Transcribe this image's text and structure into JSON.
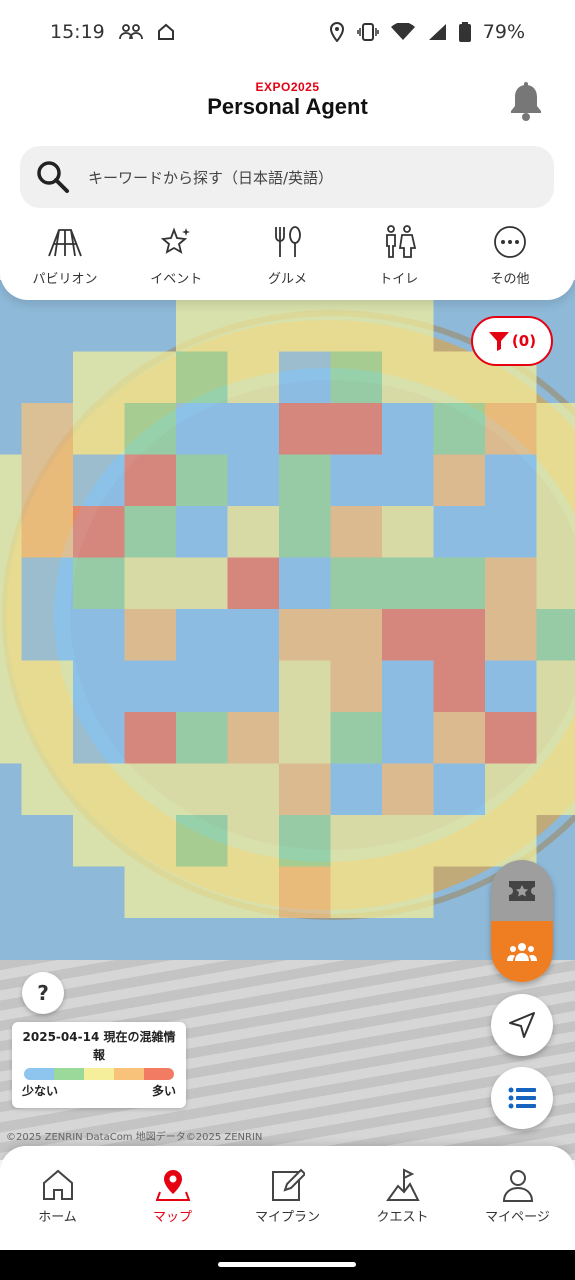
{
  "status": {
    "time": "15:19",
    "battery": "79%"
  },
  "header": {
    "brand_small": "EXPO2025",
    "brand_big": "Personal Agent",
    "search_placeholder": "キーワードから探す（日本語/英語）",
    "categories": [
      {
        "label": "パビリオン",
        "icon": "pavilion-icon"
      },
      {
        "label": "イベント",
        "icon": "event-icon"
      },
      {
        "label": "グルメ",
        "icon": "gourmet-icon"
      },
      {
        "label": "トイレ",
        "icon": "toilet-icon"
      },
      {
        "label": "その他",
        "icon": "more-icon"
      }
    ]
  },
  "map": {
    "filter_count": "(0)",
    "legend": {
      "title": "2025-04-14 現在の混雑情報",
      "low": "少ない",
      "high": "多い"
    },
    "copyright": "©2025 ZENRIN DataCom 地図データ©2025 ZENRIN",
    "help": "?"
  },
  "colors": {
    "accent": "#e50012",
    "orange": "#ef7d22",
    "level1": "#8ec5ef",
    "level2": "#9bd99b",
    "level3": "#f5ee9a",
    "level4": "#f8c27a",
    "level5": "#f27b63"
  },
  "tabs": [
    {
      "label": "ホーム",
      "icon": "home-icon",
      "active": false
    },
    {
      "label": "マップ",
      "icon": "map-pin-icon",
      "active": true
    },
    {
      "label": "マイプラン",
      "icon": "edit-icon",
      "active": false
    },
    {
      "label": "クエスト",
      "icon": "flag-icon",
      "active": false
    },
    {
      "label": "マイページ",
      "icon": "person-icon",
      "active": false
    }
  ]
}
